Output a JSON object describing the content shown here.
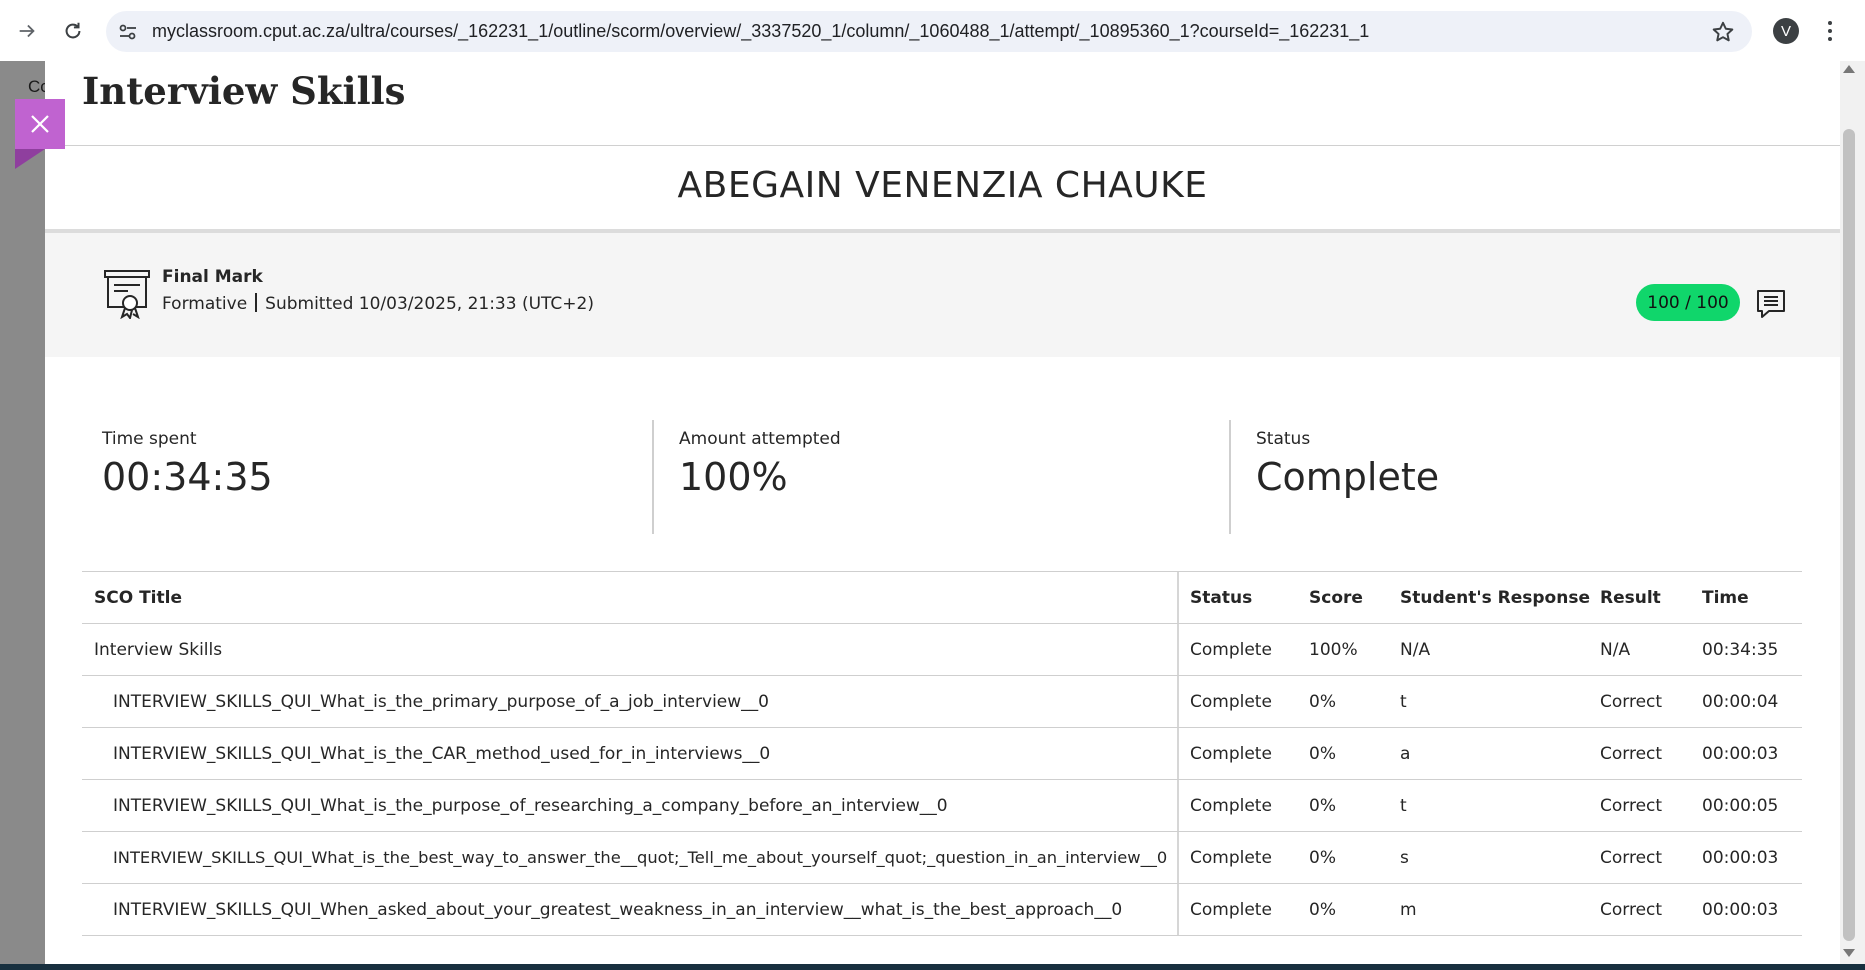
{
  "browser": {
    "url": "myclassroom.cput.ac.za/ultra/courses/_162231_1/outline/scorm/overview/_3337520_1/column/_1060488_1/attempt/_10895360_1?courseId=_162231_1",
    "profile_initial": "V",
    "icons": [
      "forward-icon",
      "reload-icon",
      "site-settings-icon",
      "bookmark-star-icon",
      "more-menu-icon"
    ]
  },
  "background": {
    "peek_text": "Co"
  },
  "panel": {
    "title": "Interview Skills",
    "student_name": "ABEGAIN VENENZIA CHAUKE",
    "close_color": "#c063d0"
  },
  "final_mark": {
    "title": "Final Mark",
    "category": "Formative",
    "submitted": "Submitted 10/03/2025, 21:33 (UTC+2)",
    "grade": "100 / 100",
    "grade_color": "#10d66b"
  },
  "stats": {
    "time_spent_label": "Time spent",
    "time_spent_value": "00:34:35",
    "amount_label": "Amount attempted",
    "amount_value": "100%",
    "status_label": "Status",
    "status_value": "Complete"
  },
  "table": {
    "headers": {
      "sco_title": "SCO Title",
      "status": "Status",
      "score": "Score",
      "response": "Student's Response",
      "result": "Result",
      "time": "Time"
    },
    "rows": [
      {
        "title": "Interview Skills",
        "status": "Complete",
        "score": "100%",
        "response": "N/A",
        "result": "N/A",
        "time": "00:34:35"
      },
      {
        "title": "INTERVIEW_SKILLS_QUI_What_is_the_primary_purpose_of_a_job_interview__0",
        "status": "Complete",
        "score": "0%",
        "response": "t",
        "result": "Correct",
        "time": "00:00:04"
      },
      {
        "title": "INTERVIEW_SKILLS_QUI_What_is_the_CAR_method_used_for_in_interviews__0",
        "status": "Complete",
        "score": "0%",
        "response": "a",
        "result": "Correct",
        "time": "00:00:03"
      },
      {
        "title": "INTERVIEW_SKILLS_QUI_What_is_the_purpose_of_researching_a_company_before_an_interview__0",
        "status": "Complete",
        "score": "0%",
        "response": "t",
        "result": "Correct",
        "time": "00:00:05"
      },
      {
        "title": "INTERVIEW_SKILLS_QUI_What_is_the_best_way_to_answer_the__quot;_Tell_me_about_yourself_quot;_question_in_an_interview__0",
        "status": "Complete",
        "score": "0%",
        "response": "s",
        "result": "Correct",
        "time": "00:00:03"
      },
      {
        "title": "INTERVIEW_SKILLS_QUI_When_asked_about_your_greatest_weakness_in_an_interview__what_is_the_best_approach__0",
        "status": "Complete",
        "score": "0%",
        "response": "m",
        "result": "Correct",
        "time": "00:00:03"
      }
    ]
  }
}
